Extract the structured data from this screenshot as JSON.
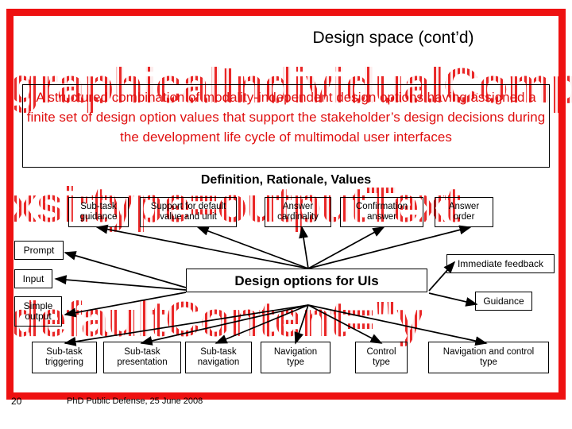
{
  "slide": {
    "title": "Design space (cont’d)",
    "definition": "A structured combination of modality-independent design options having assigned a finite set of design option values that support the stakeholder’s design decisions during the development life cycle of multimodal user interfaces",
    "definition_caption": "Definition, Rationale, Values",
    "page_number": "20",
    "footer": "PhD Public Defense, 25 June 2008",
    "accent_color": "#ee1111",
    "definition_color": "#e01010"
  },
  "watermark": {
    "line1": "graphicalIndividualComponent",
    "line2": "xsi:type=outputText",
    "line3": "defaultContent=\"y"
  },
  "diagram": {
    "center": "Design options for UIs",
    "top_row": [
      {
        "label": "Sub-task\nguidance"
      },
      {
        "label": "Support for default\nvalue and unit"
      },
      {
        "label": "Answer\ncardinality"
      },
      {
        "label": "Confirmation\nanswer"
      },
      {
        "label": "Answer\norder"
      }
    ],
    "left_column": [
      {
        "label": "Prompt"
      },
      {
        "label": "Input"
      },
      {
        "label": "Simple\noutput"
      }
    ],
    "right_column": [
      {
        "label": "Immediate feedback"
      },
      {
        "label": "Guidance"
      }
    ],
    "bottom_row": [
      {
        "label": "Sub-task\ntriggering"
      },
      {
        "label": "Sub-task\npresentation"
      },
      {
        "label": "Sub-task\nnavigation"
      },
      {
        "label": "Navigation\ntype"
      },
      {
        "label": "Control\ntype"
      },
      {
        "label": "Navigation and control\ntype"
      }
    ]
  }
}
